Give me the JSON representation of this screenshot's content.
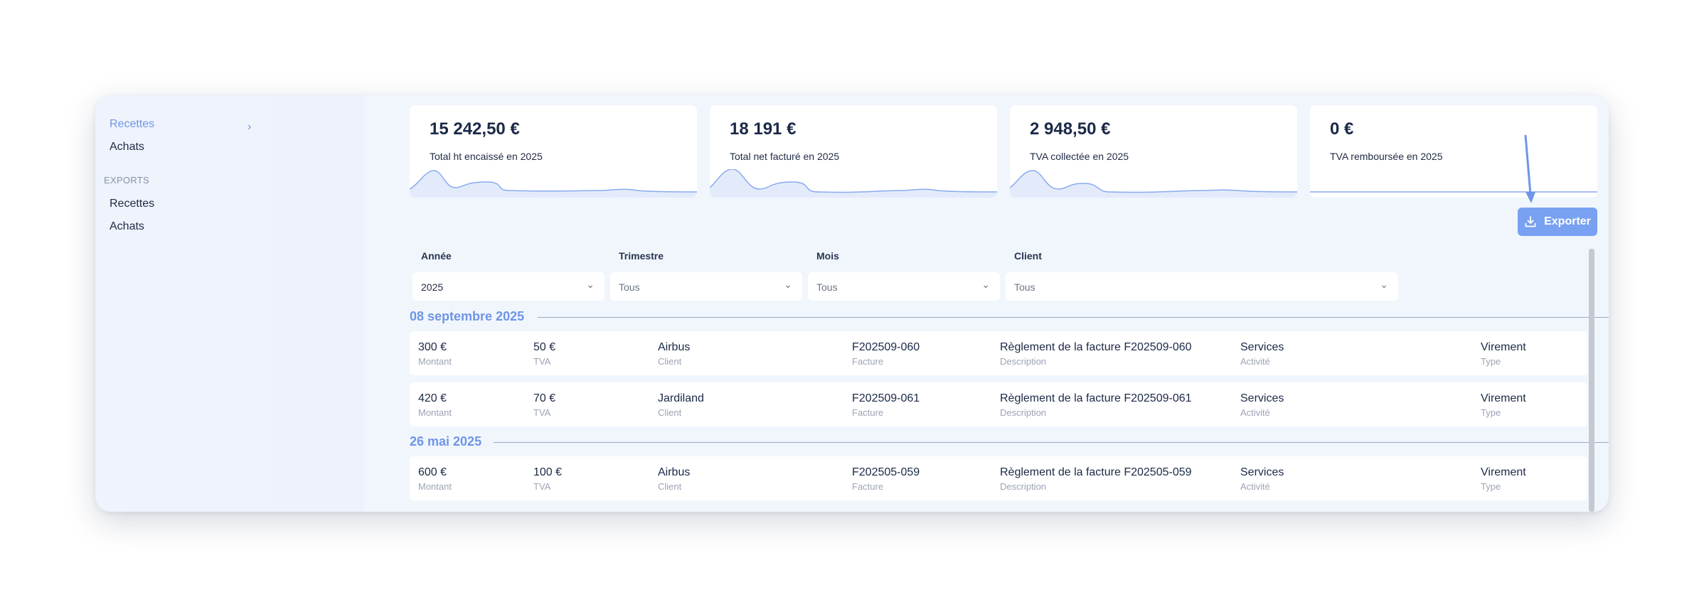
{
  "sidebar": {
    "items": [
      {
        "label": "Recettes"
      },
      {
        "label": "Achats"
      }
    ],
    "section": "EXPORTS",
    "export_items": [
      {
        "label": "Recettes"
      },
      {
        "label": "Achats"
      }
    ]
  },
  "kpis": [
    {
      "value": "15 242,50 €",
      "label": "Total ht encaissé en 2025"
    },
    {
      "value": "18 191 €",
      "label": "Total net facturé en 2025"
    },
    {
      "value": "2 948,50 €",
      "label": "TVA collectée en 2025"
    },
    {
      "value": "0 €",
      "label": "TVA remboursée en 2025"
    }
  ],
  "colors": {
    "accent": "#6e95e6",
    "button": "#79a1f2",
    "background": "#f1f6fd"
  },
  "export_button": {
    "label": "Exporter",
    "icon": "download-icon"
  },
  "filters": [
    {
      "label": "Année",
      "value": "2025"
    },
    {
      "label": "Trimestre",
      "value": "Tous"
    },
    {
      "label": "Mois",
      "value": "Tous"
    },
    {
      "label": "Client",
      "value": "Tous"
    }
  ],
  "groups": [
    {
      "date": "08 septembre 2025",
      "rows": [
        {
          "montant": "300 €",
          "tva": "50 €",
          "client": "Airbus",
          "facture": "F202509-060",
          "description": "Règlement de la facture F202509-060",
          "activite": "Services",
          "type": "Virement"
        },
        {
          "montant": "420 €",
          "tva": "70 €",
          "client": "Jardiland",
          "facture": "F202509-061",
          "description": "Règlement de la facture F202509-061",
          "activite": "Services",
          "type": "Virement"
        }
      ]
    },
    {
      "date": "26 mai 2025",
      "rows": [
        {
          "montant": "600 €",
          "tva": "100 €",
          "client": "Airbus",
          "facture": "F202505-059",
          "description": "Règlement de la facture F202505-059",
          "activite": "Services",
          "type": "Virement"
        }
      ]
    }
  ],
  "field_labels": {
    "montant": "Montant",
    "tva": "TVA",
    "client": "Client",
    "facture": "Facture",
    "description": "Description",
    "activite": "Activité",
    "type": "Type"
  }
}
